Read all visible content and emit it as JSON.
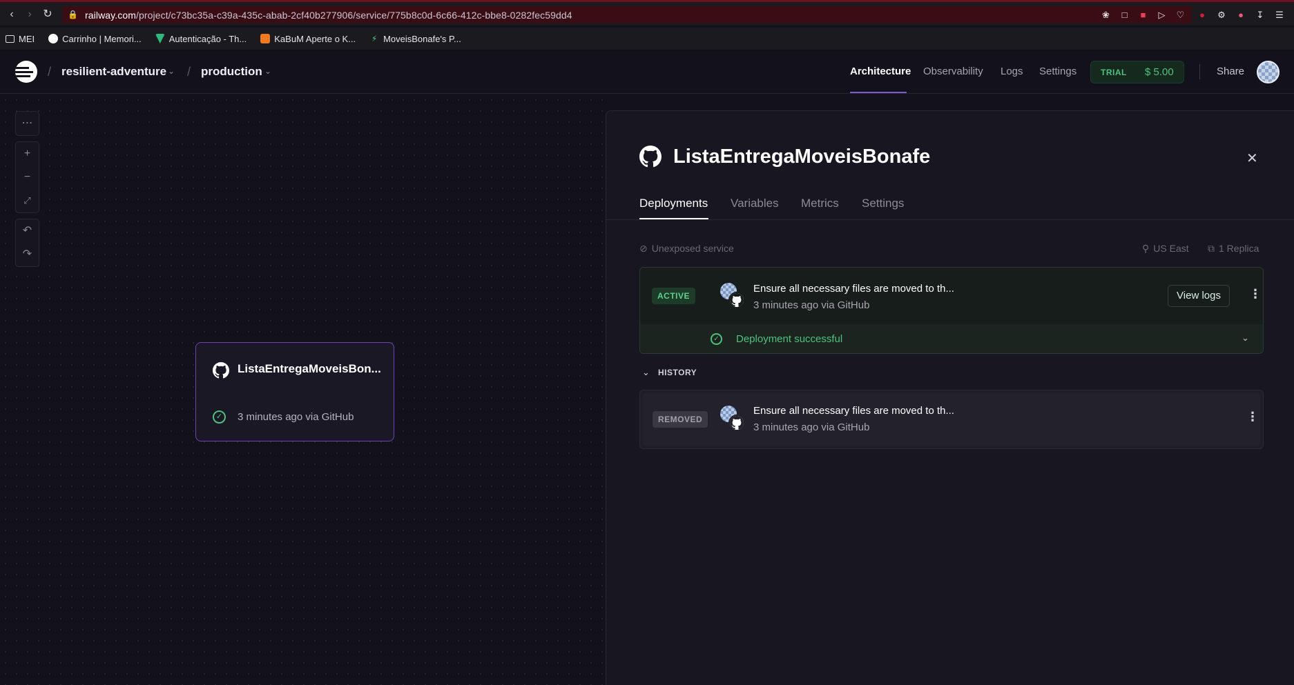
{
  "browser": {
    "url_domain": "railway.com",
    "url_path": "/project/c73bc35a-c39a-435c-abab-2cf40b277906/service/775b8c0d-6c66-412c-bbe8-0282fec59dd4",
    "bookmarks": [
      {
        "label": "MEI",
        "icon": "folder-icon"
      },
      {
        "label": "Carrinho | Memori...",
        "icon": "site-icon"
      },
      {
        "label": "Autenticação - Th...",
        "icon": "site-icon"
      },
      {
        "label": "KaBuM Aperte o K...",
        "icon": "site-icon"
      },
      {
        "label": "MoveisBonafe's P...",
        "icon": "site-icon"
      }
    ]
  },
  "header": {
    "project": "resilient-adventure",
    "environment": "production",
    "nav": [
      "Architecture",
      "Observability",
      "Logs",
      "Settings"
    ],
    "active_nav": "Architecture",
    "trial_label": "TRIAL",
    "trial_price": "$ 5.00",
    "share": "Share"
  },
  "canvas": {
    "service_name": "ListaEntregaMoveisBon...",
    "service_status": "3 minutes ago via GitHub"
  },
  "panel": {
    "title": "ListaEntregaMoveisBonafe",
    "tabs": [
      "Deployments",
      "Variables",
      "Metrics",
      "Settings"
    ],
    "active_tab": "Deployments",
    "exposure": "Unexposed service",
    "region": "US East",
    "replicas": "1 Replica",
    "active_deployment": {
      "badge": "ACTIVE",
      "commit": "Ensure all necessary files are moved to th...",
      "meta": "3 minutes ago via GitHub",
      "view_logs": "View logs",
      "status": "Deployment successful"
    },
    "history_label": "HISTORY",
    "history": [
      {
        "badge": "REMOVED",
        "commit": "Ensure all necessary files are moved to th...",
        "meta": "3 minutes ago via GitHub"
      }
    ]
  },
  "colors": {
    "accent": "#7b5bd9",
    "success": "#4ec27d",
    "background": "#13111c"
  }
}
